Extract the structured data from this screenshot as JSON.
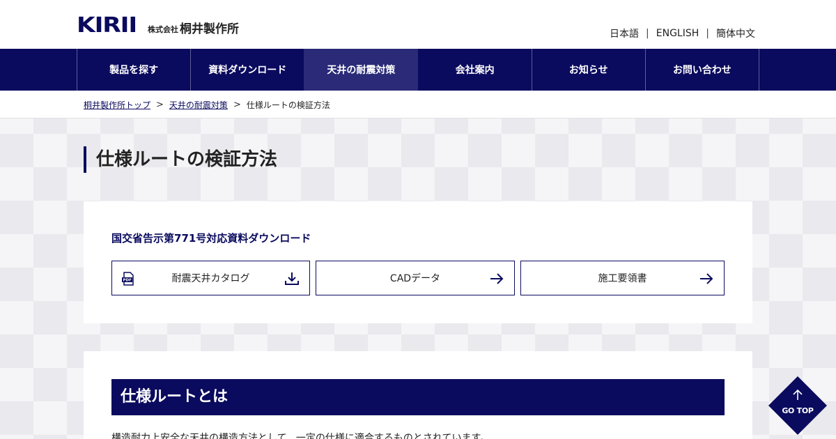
{
  "header": {
    "logo_mark": "KIRII",
    "logo_small": "株式会社",
    "logo_name": "桐井製作所",
    "languages": [
      "日本語",
      "ENGLISH",
      "簡体中文"
    ]
  },
  "nav": {
    "items": [
      {
        "label": "製品を探す"
      },
      {
        "label": "資料ダウンロード"
      },
      {
        "label": "天井の耐震対策"
      },
      {
        "label": "会社案内"
      },
      {
        "label": "お知らせ"
      },
      {
        "label": "お問い合わせ"
      }
    ],
    "active_index": 2
  },
  "breadcrumb": {
    "items": [
      "桐井製作所トップ",
      "天井の耐震対策",
      "仕様ルートの検証方法"
    ],
    "separator": ">"
  },
  "page": {
    "title": "仕様ルートの検証方法"
  },
  "downloads": {
    "heading": "国交省告示第771号対応資料ダウンロード",
    "buttons": [
      {
        "label": "耐震天井カタログ",
        "lead_icon": "pdf-icon",
        "trail_icon": "download-icon"
      },
      {
        "label": "CADデータ",
        "trail_icon": "arrow-right-icon"
      },
      {
        "label": "施工要領書",
        "trail_icon": "arrow-right-icon"
      }
    ]
  },
  "section": {
    "heading": "仕様ルートとは",
    "text": "構造耐力上安全な天井の構造方法として、一定の仕様に適合するものとされています。"
  },
  "gotop": {
    "label": "GO TOP"
  },
  "colors": {
    "navy": "#0a0a5e",
    "nav_active": "#2a2a78"
  }
}
